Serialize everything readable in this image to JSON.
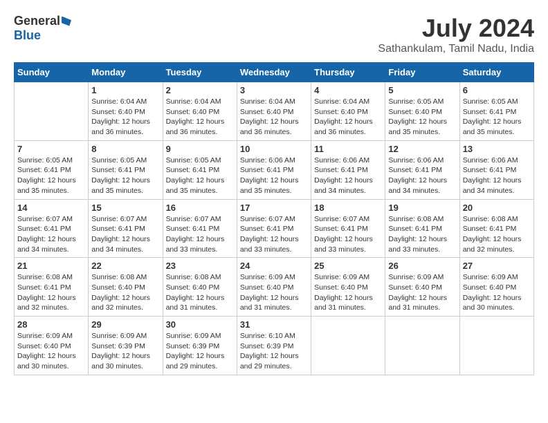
{
  "logo": {
    "general": "General",
    "blue": "Blue"
  },
  "title": {
    "month_year": "July 2024",
    "location": "Sathankulam, Tamil Nadu, India"
  },
  "weekdays": [
    "Sunday",
    "Monday",
    "Tuesday",
    "Wednesday",
    "Thursday",
    "Friday",
    "Saturday"
  ],
  "weeks": [
    [
      {
        "day": "",
        "sunrise": "",
        "sunset": "",
        "daylight": ""
      },
      {
        "day": "1",
        "sunrise": "Sunrise: 6:04 AM",
        "sunset": "Sunset: 6:40 PM",
        "daylight": "Daylight: 12 hours and 36 minutes."
      },
      {
        "day": "2",
        "sunrise": "Sunrise: 6:04 AM",
        "sunset": "Sunset: 6:40 PM",
        "daylight": "Daylight: 12 hours and 36 minutes."
      },
      {
        "day": "3",
        "sunrise": "Sunrise: 6:04 AM",
        "sunset": "Sunset: 6:40 PM",
        "daylight": "Daylight: 12 hours and 36 minutes."
      },
      {
        "day": "4",
        "sunrise": "Sunrise: 6:04 AM",
        "sunset": "Sunset: 6:40 PM",
        "daylight": "Daylight: 12 hours and 36 minutes."
      },
      {
        "day": "5",
        "sunrise": "Sunrise: 6:05 AM",
        "sunset": "Sunset: 6:40 PM",
        "daylight": "Daylight: 12 hours and 35 minutes."
      },
      {
        "day": "6",
        "sunrise": "Sunrise: 6:05 AM",
        "sunset": "Sunset: 6:41 PM",
        "daylight": "Daylight: 12 hours and 35 minutes."
      }
    ],
    [
      {
        "day": "7",
        "sunrise": "Sunrise: 6:05 AM",
        "sunset": "Sunset: 6:41 PM",
        "daylight": "Daylight: 12 hours and 35 minutes."
      },
      {
        "day": "8",
        "sunrise": "Sunrise: 6:05 AM",
        "sunset": "Sunset: 6:41 PM",
        "daylight": "Daylight: 12 hours and 35 minutes."
      },
      {
        "day": "9",
        "sunrise": "Sunrise: 6:05 AM",
        "sunset": "Sunset: 6:41 PM",
        "daylight": "Daylight: 12 hours and 35 minutes."
      },
      {
        "day": "10",
        "sunrise": "Sunrise: 6:06 AM",
        "sunset": "Sunset: 6:41 PM",
        "daylight": "Daylight: 12 hours and 35 minutes."
      },
      {
        "day": "11",
        "sunrise": "Sunrise: 6:06 AM",
        "sunset": "Sunset: 6:41 PM",
        "daylight": "Daylight: 12 hours and 34 minutes."
      },
      {
        "day": "12",
        "sunrise": "Sunrise: 6:06 AM",
        "sunset": "Sunset: 6:41 PM",
        "daylight": "Daylight: 12 hours and 34 minutes."
      },
      {
        "day": "13",
        "sunrise": "Sunrise: 6:06 AM",
        "sunset": "Sunset: 6:41 PM",
        "daylight": "Daylight: 12 hours and 34 minutes."
      }
    ],
    [
      {
        "day": "14",
        "sunrise": "Sunrise: 6:07 AM",
        "sunset": "Sunset: 6:41 PM",
        "daylight": "Daylight: 12 hours and 34 minutes."
      },
      {
        "day": "15",
        "sunrise": "Sunrise: 6:07 AM",
        "sunset": "Sunset: 6:41 PM",
        "daylight": "Daylight: 12 hours and 34 minutes."
      },
      {
        "day": "16",
        "sunrise": "Sunrise: 6:07 AM",
        "sunset": "Sunset: 6:41 PM",
        "daylight": "Daylight: 12 hours and 33 minutes."
      },
      {
        "day": "17",
        "sunrise": "Sunrise: 6:07 AM",
        "sunset": "Sunset: 6:41 PM",
        "daylight": "Daylight: 12 hours and 33 minutes."
      },
      {
        "day": "18",
        "sunrise": "Sunrise: 6:07 AM",
        "sunset": "Sunset: 6:41 PM",
        "daylight": "Daylight: 12 hours and 33 minutes."
      },
      {
        "day": "19",
        "sunrise": "Sunrise: 6:08 AM",
        "sunset": "Sunset: 6:41 PM",
        "daylight": "Daylight: 12 hours and 33 minutes."
      },
      {
        "day": "20",
        "sunrise": "Sunrise: 6:08 AM",
        "sunset": "Sunset: 6:41 PM",
        "daylight": "Daylight: 12 hours and 32 minutes."
      }
    ],
    [
      {
        "day": "21",
        "sunrise": "Sunrise: 6:08 AM",
        "sunset": "Sunset: 6:41 PM",
        "daylight": "Daylight: 12 hours and 32 minutes."
      },
      {
        "day": "22",
        "sunrise": "Sunrise: 6:08 AM",
        "sunset": "Sunset: 6:40 PM",
        "daylight": "Daylight: 12 hours and 32 minutes."
      },
      {
        "day": "23",
        "sunrise": "Sunrise: 6:08 AM",
        "sunset": "Sunset: 6:40 PM",
        "daylight": "Daylight: 12 hours and 31 minutes."
      },
      {
        "day": "24",
        "sunrise": "Sunrise: 6:09 AM",
        "sunset": "Sunset: 6:40 PM",
        "daylight": "Daylight: 12 hours and 31 minutes."
      },
      {
        "day": "25",
        "sunrise": "Sunrise: 6:09 AM",
        "sunset": "Sunset: 6:40 PM",
        "daylight": "Daylight: 12 hours and 31 minutes."
      },
      {
        "day": "26",
        "sunrise": "Sunrise: 6:09 AM",
        "sunset": "Sunset: 6:40 PM",
        "daylight": "Daylight: 12 hours and 31 minutes."
      },
      {
        "day": "27",
        "sunrise": "Sunrise: 6:09 AM",
        "sunset": "Sunset: 6:40 PM",
        "daylight": "Daylight: 12 hours and 30 minutes."
      }
    ],
    [
      {
        "day": "28",
        "sunrise": "Sunrise: 6:09 AM",
        "sunset": "Sunset: 6:40 PM",
        "daylight": "Daylight: 12 hours and 30 minutes."
      },
      {
        "day": "29",
        "sunrise": "Sunrise: 6:09 AM",
        "sunset": "Sunset: 6:39 PM",
        "daylight": "Daylight: 12 hours and 30 minutes."
      },
      {
        "day": "30",
        "sunrise": "Sunrise: 6:09 AM",
        "sunset": "Sunset: 6:39 PM",
        "daylight": "Daylight: 12 hours and 29 minutes."
      },
      {
        "day": "31",
        "sunrise": "Sunrise: 6:10 AM",
        "sunset": "Sunset: 6:39 PM",
        "daylight": "Daylight: 12 hours and 29 minutes."
      },
      {
        "day": "",
        "sunrise": "",
        "sunset": "",
        "daylight": ""
      },
      {
        "day": "",
        "sunrise": "",
        "sunset": "",
        "daylight": ""
      },
      {
        "day": "",
        "sunrise": "",
        "sunset": "",
        "daylight": ""
      }
    ]
  ]
}
